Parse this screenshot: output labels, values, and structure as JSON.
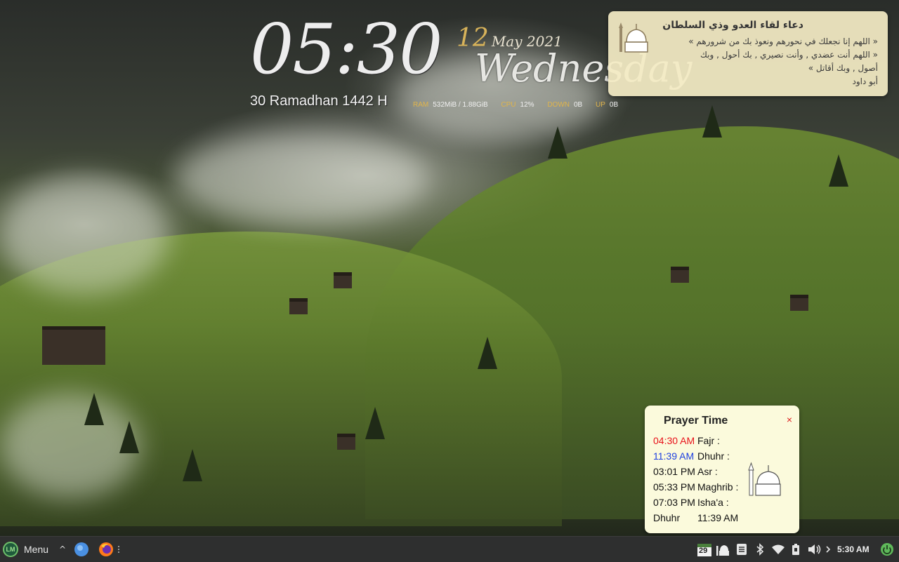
{
  "desklet": {
    "time": "05:30",
    "day_num": "12",
    "month_year": "May 2021",
    "weekday": "Wednesday",
    "hijri": "30 Ramadhan 1442 H",
    "stats": [
      {
        "label": "RAM",
        "value": "532MiB / 1.88GiB"
      },
      {
        "label": "CPU",
        "value": "12%"
      },
      {
        "label": "DOWN",
        "value": "0B"
      },
      {
        "label": "UP",
        "value": "0B"
      }
    ]
  },
  "dua": {
    "title": "دعاء لقاء العدو وذي السلطان",
    "lines": [
      "« اللهم إنا نجعلك في نحورهم ونعوذ بك من شرورهم »",
      "« اللهم أنت عضدي , وأنت نصيري , بك أحول , وبك",
      "أصول , وبك أقاتل »",
      "أبو داود"
    ]
  },
  "prayer": {
    "title": "Prayer Time",
    "close": "×",
    "rows": [
      {
        "time": "04:30 AM",
        "name": "Fajr :",
        "color": "#e8131b"
      },
      {
        "time": "11:39 AM",
        "name": "Dhuhr :",
        "color": "#1d3fe0"
      },
      {
        "time": "03:01 PM",
        "name": "Asr :",
        "color": "#111111"
      },
      {
        "time": "05:33 PM",
        "name": "Maghrib :",
        "color": "#111111"
      },
      {
        "time": "07:03 PM",
        "name": "Isha'a :",
        "color": "#111111"
      }
    ],
    "next_name": "Dhuhr",
    "next_time": "11:39 AM"
  },
  "taskbar": {
    "menu_label": "Menu",
    "expand_glyph": "^",
    "calendar_day": "29",
    "clock": "5:30 AM",
    "colors": {
      "bg": "#2e2f2f",
      "accent": "#6fbf6a"
    },
    "tray_icons": [
      "calendar-icon",
      "mosque-icon",
      "notes-icon",
      "bluetooth-icon",
      "wifi-icon",
      "battery-icon",
      "volume-icon",
      "chevron-right-icon"
    ]
  }
}
